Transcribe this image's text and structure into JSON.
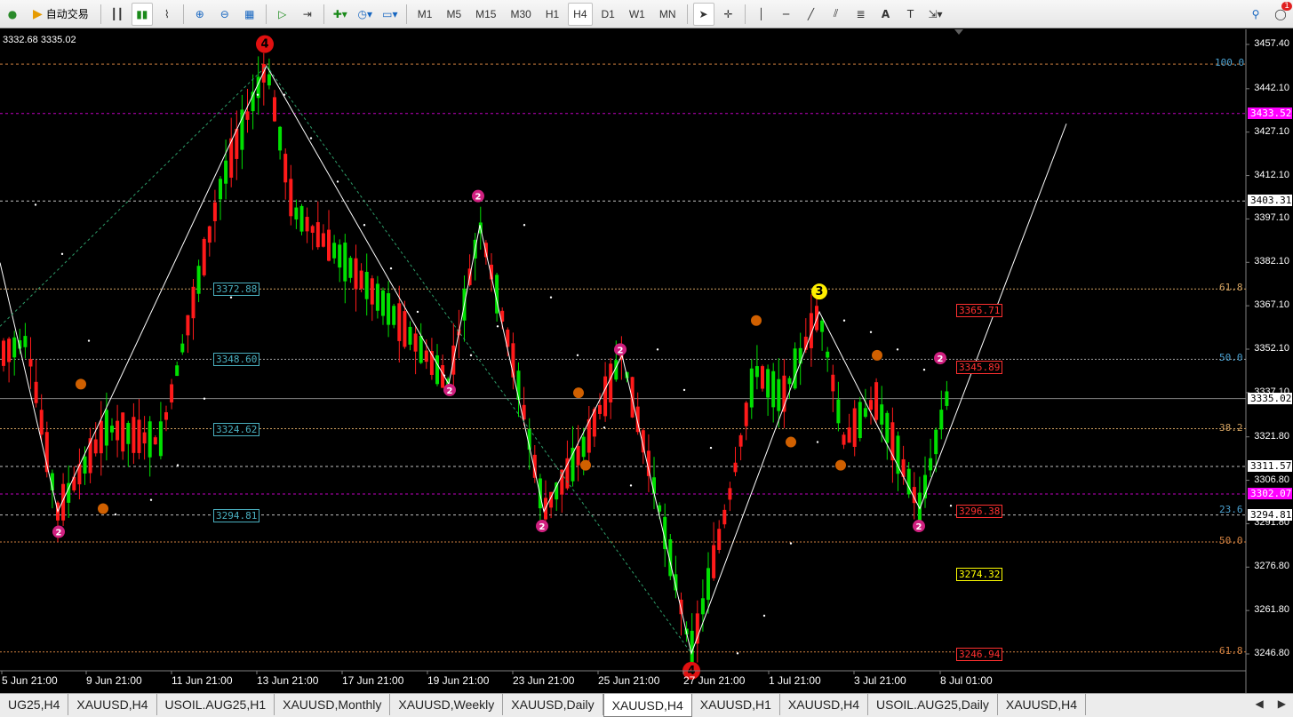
{
  "toolbar": {
    "auto_trading_label": "自动交易",
    "timeframes": [
      "M1",
      "M5",
      "M15",
      "M30",
      "H1",
      "H4",
      "D1",
      "W1",
      "MN"
    ],
    "active_timeframe": "H4",
    "alert_badge": "1"
  },
  "chart": {
    "quote": "3332.68 3335.02",
    "price_axis": [
      "3457.40",
      "3442.10",
      "3427.10",
      "3412.10",
      "3397.10",
      "3382.10",
      "3367.10",
      "3352.10",
      "3337.10",
      "3321.80",
      "3306.80",
      "3291.80",
      "3276.80",
      "3261.80",
      "3246.80"
    ],
    "price_tags": [
      {
        "text": "3433.52",
        "bg": "#ff00ff",
        "fg": "#ffffff"
      },
      {
        "text": "3403.31",
        "bg": "#ffffff",
        "fg": "#000000"
      },
      {
        "text": "3335.02",
        "bg": "#ffffff",
        "fg": "#000000"
      },
      {
        "text": "3311.57",
        "bg": "#ffffff",
        "fg": "#000000"
      },
      {
        "text": "3302.07",
        "bg": "#ff00ff",
        "fg": "#ffffff"
      },
      {
        "text": "3294.81",
        "bg": "#ffffff",
        "fg": "#000000"
      }
    ],
    "fib_labels": [
      "100.0",
      "61.8",
      "50.0",
      "38.2",
      "23.6",
      "50.0",
      "61.8"
    ],
    "level_labels": [
      "3372.88",
      "3348.60",
      "3324.62",
      "3294.81"
    ],
    "right_labels": [
      {
        "text": "3365.71",
        "color": "#ff3030"
      },
      {
        "text": "3345.89",
        "color": "#ff3030"
      },
      {
        "text": "3296.38",
        "color": "#ff3030"
      },
      {
        "text": "3274.32",
        "color": "#ffff00"
      },
      {
        "text": "3246.94",
        "color": "#ff3030"
      }
    ],
    "wave_markers": [
      "4",
      "2",
      "2",
      "2",
      "2",
      "2",
      "3",
      "2",
      "2",
      "4"
    ],
    "dates": [
      "5 Jun 21:00",
      "9 Jun 21:00",
      "11 Jun 21:00",
      "13 Jun 21:00",
      "17 Jun 21:00",
      "19 Jun 21:00",
      "23 Jun 21:00",
      "25 Jun 21:00",
      "27 Jun 21:00",
      "1 Jul 21:00",
      "3 Jul 21:00",
      "8 Jul 01:00"
    ]
  },
  "tabs": [
    "UG25,H4",
    "XAUUSD,H4",
    "USOIL.AUG25,H1",
    "XAUUSD,Monthly",
    "XAUUSD,Weekly",
    "XAUUSD,Daily",
    "XAUUSD,H4",
    "XAUUSD,H1",
    "XAUUSD,H4",
    "USOIL.AUG25,Daily",
    "XAUUSD,H4"
  ],
  "active_tab_index": 6,
  "colors": {
    "bull": "#00e000",
    "bear": "#ff1a1a",
    "zigzag": "#ffffff"
  }
}
